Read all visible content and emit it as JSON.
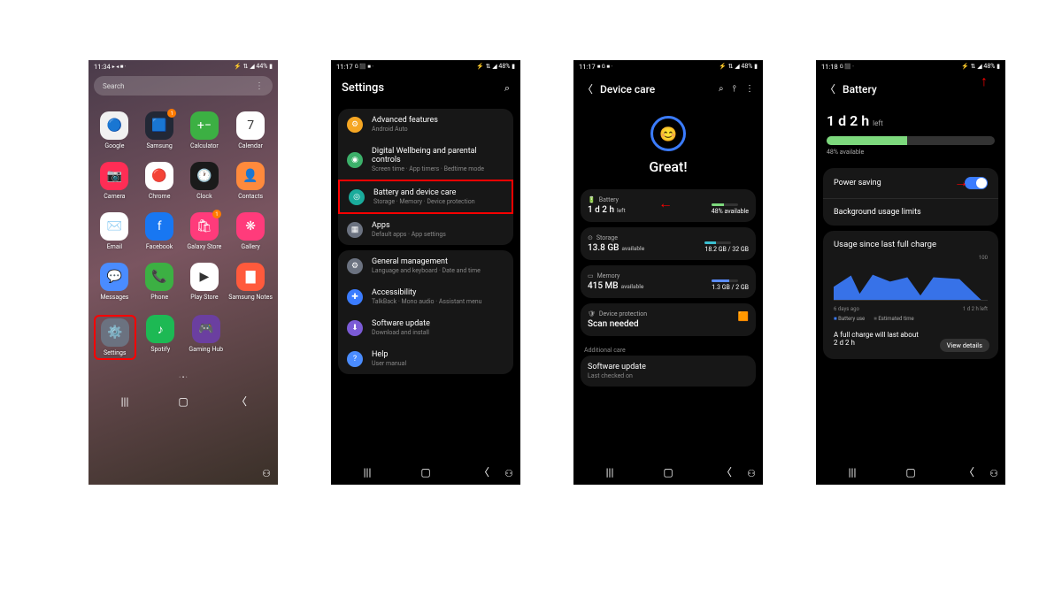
{
  "screen1": {
    "time": "11:34",
    "status_icons": "▸ ◂ ■ ·",
    "battery_text": "44%",
    "signal": "⚡ ⇅ ◢ 44% ▮",
    "search_placeholder": "Search",
    "apps": [
      {
        "label": "Google",
        "bg": "#f1f1f1",
        "emoji": "🔵",
        "badge": ""
      },
      {
        "label": "Samsung",
        "bg": "#222836",
        "emoji": "🟦",
        "badge": "1"
      },
      {
        "label": "Calculator",
        "bg": "#3cb043",
        "emoji": "+−",
        "badge": ""
      },
      {
        "label": "Calendar",
        "bg": "#ffffff",
        "emoji": "7",
        "badge": ""
      },
      {
        "label": "Camera",
        "bg": "#ff2d55",
        "emoji": "📷",
        "badge": ""
      },
      {
        "label": "Chrome",
        "bg": "#ffffff",
        "emoji": "🔴",
        "badge": ""
      },
      {
        "label": "Clock",
        "bg": "#1a1a1a",
        "emoji": "🕐",
        "badge": ""
      },
      {
        "label": "Contacts",
        "bg": "#ff8a3c",
        "emoji": "👤",
        "badge": ""
      },
      {
        "label": "Email",
        "bg": "#ffffff",
        "emoji": "✉️",
        "badge": ""
      },
      {
        "label": "Facebook",
        "bg": "#1877f2",
        "emoji": "f",
        "badge": ""
      },
      {
        "label": "Galaxy Store",
        "bg": "#ff3b7b",
        "emoji": "🛍",
        "badge": "1"
      },
      {
        "label": "Gallery",
        "bg": "#ff3b7b",
        "emoji": "❋",
        "badge": ""
      },
      {
        "label": "Messages",
        "bg": "#4a8cff",
        "emoji": "💬",
        "badge": ""
      },
      {
        "label": "Phone",
        "bg": "#3cb043",
        "emoji": "📞",
        "badge": ""
      },
      {
        "label": "Play Store",
        "bg": "#ffffff",
        "emoji": "▶",
        "badge": ""
      },
      {
        "label": "Samsung Notes",
        "bg": "#ff5a3c",
        "emoji": "▇",
        "badge": ""
      }
    ],
    "apps_row2": [
      {
        "label": "Settings",
        "bg": "#6b7280",
        "emoji": "⚙️",
        "hl": true
      },
      {
        "label": "Spotify",
        "bg": "#1db954",
        "emoji": "♪",
        "hl": false
      },
      {
        "label": "Gaming Hub",
        "bg": "#6b3fa0",
        "emoji": "🎮",
        "hl": false
      }
    ],
    "dots": "·  •  ·"
  },
  "screen2": {
    "time": "11:17",
    "status_icons": "G ⬛ ■ ·",
    "signal": "⚡ ⇅ ◢ 48% ▮",
    "title": "Settings",
    "groups": [
      [
        {
          "icon": "⚙",
          "color": "#f5a623",
          "title": "Advanced features",
          "sub": "Android Auto"
        },
        {
          "icon": "◉",
          "color": "#3cb06a",
          "title": "Digital Wellbeing and parental controls",
          "sub": "Screen time  ·  App timers  ·  Bedtime mode"
        },
        {
          "icon": "◎",
          "color": "#1aab9b",
          "title": "Battery and device care",
          "sub": "Storage  ·  Memory  ·  Device protection",
          "hl": true
        },
        {
          "icon": "▦",
          "color": "#6b7280",
          "title": "Apps",
          "sub": "Default apps  ·  App settings"
        }
      ],
      [
        {
          "icon": "⚙",
          "color": "#6b7280",
          "title": "General management",
          "sub": "Language and keyboard  ·  Date and time"
        },
        {
          "icon": "✚",
          "color": "#3b7cff",
          "title": "Accessibility",
          "sub": "TalkBack  ·  Mono audio  ·  Assistant menu"
        },
        {
          "icon": "⬇",
          "color": "#7b5bd6",
          "title": "Software update",
          "sub": "Download and install"
        },
        {
          "icon": "?",
          "color": "#4a8cff",
          "title": "Help",
          "sub": "User manual"
        }
      ]
    ]
  },
  "screen3": {
    "time": "11:17",
    "status_icons": "■ G ■ ·",
    "signal": "⚡ ⇅ ◢ 48% ▮",
    "title": "Device care",
    "status": "Great!",
    "battery": {
      "label": "Battery",
      "time": "1 d 2 h",
      "suffix": "left",
      "pct": "48% available",
      "fill": 48,
      "color": "#7dd87d"
    },
    "storage": {
      "label": "Storage",
      "main": "13.8 GB",
      "suffix": "available",
      "right": "18.2 GB / 32 GB",
      "fill": 43,
      "color": "#3bbfd1"
    },
    "memory": {
      "label": "Memory",
      "main": "415 MB",
      "suffix": "available",
      "right": "1.3 GB / 2 GB",
      "fill": 65,
      "color": "#5b8cff"
    },
    "protection": {
      "label": "Device protection",
      "main": "Scan needed"
    },
    "additional": "Additional care",
    "sw": {
      "title": "Software update",
      "sub": "Last checked on"
    }
  },
  "screen4": {
    "time": "11:18",
    "status_icons": "G ⬛ ·",
    "signal": "⚡ ⇅ ◢ 48% ▮",
    "title": "Battery",
    "remain": "1 d 2 h",
    "remain_sfx": "left",
    "fill": 48,
    "avail": "48% available",
    "power_saving": "Power saving",
    "bg_limits": "Background usage limits",
    "usage_title": "Usage since last full charge",
    "chart_left": "6 days ago",
    "chart_right": "1 d 2 h left",
    "chart_max": "100",
    "legend1": "Battery use",
    "legend2": "Estimated time",
    "full_txt": "A full charge will last about",
    "full_time": "2 d 2 h",
    "view_btn": "View details"
  },
  "chart_data": {
    "type": "area",
    "title": "Usage since last full charge",
    "xlabel": "",
    "ylabel": "%",
    "ylim": [
      0,
      100
    ],
    "categories": [
      "6 days ago",
      "",
      "",
      "",
      "",
      "",
      "1 d 2 h left"
    ],
    "series": [
      {
        "name": "Battery use",
        "values": [
          30,
          55,
          15,
          58,
          42,
          52,
          10,
          48,
          0
        ]
      },
      {
        "name": "Estimated time",
        "values": [
          0,
          0,
          0,
          0,
          0,
          0,
          0,
          48,
          0
        ]
      }
    ]
  }
}
